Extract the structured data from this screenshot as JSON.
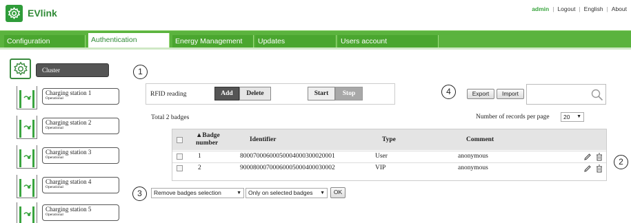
{
  "app": {
    "title": "EVlink"
  },
  "toplinks": {
    "user": "admin",
    "logout": "Logout",
    "language": "English",
    "about": "About"
  },
  "nav": {
    "tabs": [
      {
        "label": "Configuration",
        "active": false
      },
      {
        "label": "Authentication",
        "active": true
      },
      {
        "label": "Energy Management",
        "active": false
      },
      {
        "label": "Updates",
        "active": false
      },
      {
        "label": "Users account",
        "active": false
      }
    ]
  },
  "sidebar": {
    "cluster_label": "Cluster",
    "stations": [
      {
        "name": "Charging station 1",
        "status": "Operational"
      },
      {
        "name": "Charging station 2",
        "status": "Operational"
      },
      {
        "name": "Charging station 3",
        "status": "Operational"
      },
      {
        "name": "Charging station 4",
        "status": "Operational"
      },
      {
        "name": "Charging station 5",
        "status": "Operational"
      }
    ]
  },
  "callouts": [
    "1",
    "2",
    "3",
    "4"
  ],
  "rfid": {
    "label": "RFID reading",
    "add": "Add",
    "delete": "Delete",
    "start": "Start",
    "stop": "Stop"
  },
  "toolbar": {
    "export": "Export",
    "import": "Import",
    "search_value": ""
  },
  "summary": {
    "total": "Total 2 badges",
    "per_page_label": "Number of records per page",
    "per_page_value": "20"
  },
  "table": {
    "headers": {
      "badge_line1": "Badge",
      "badge_line2": "number",
      "identifier": "Identifier",
      "type": "Type",
      "comment": "Comment"
    },
    "rows": [
      {
        "number": "1",
        "identifier": "80007000600050004000300020001",
        "type": "User",
        "comment": "anonymous"
      },
      {
        "number": "2",
        "identifier": "90008000700060005000400030002",
        "type": "VIP",
        "comment": "anonymous"
      }
    ]
  },
  "bottom": {
    "action_value": "Remove badges selection",
    "scope_value": "Only on selected badges",
    "ok": "OK"
  },
  "colors": {
    "brand_green": "#3aa53f",
    "nav_green": "#5bb33e",
    "dark_button": "#555555"
  }
}
